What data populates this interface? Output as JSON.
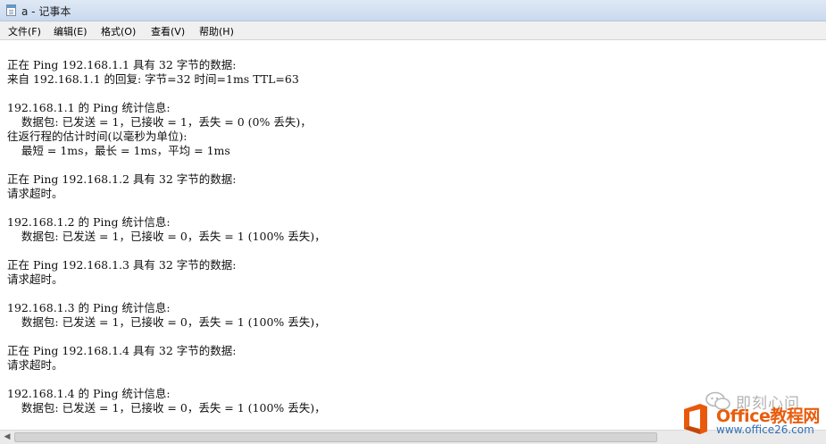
{
  "window": {
    "title": "a - 记事本"
  },
  "menu": [
    {
      "label": "文件(F)"
    },
    {
      "label": "编辑(E)"
    },
    {
      "label": "格式(O)"
    },
    {
      "label": "查看(V)"
    },
    {
      "label": "帮助(H)"
    }
  ],
  "document": {
    "lines": [
      "正在 Ping 192.168.1.1 具有 32 字节的数据:",
      "来自 192.168.1.1 的回复: 字节=32 时间=1ms TTL=63",
      "192.168.1.1 的 Ping 统计信息:",
      "    数据包: 已发送 = 1，已接收 = 1，丢失 = 0 (0% 丢失)，",
      "往返行程的估计时间(以毫秒为单位):",
      "    最短 = 1ms，最长 = 1ms，平均 = 1ms",
      "正在 Ping 192.168.1.2 具有 32 字节的数据:",
      "请求超时。",
      "192.168.1.2 的 Ping 统计信息:",
      "    数据包: 已发送 = 1，已接收 = 0，丢失 = 1 (100% 丢失)，",
      "正在 Ping 192.168.1.3 具有 32 字节的数据:",
      "请求超时。",
      "192.168.1.3 的 Ping 统计信息:",
      "    数据包: 已发送 = 1，已接收 = 0，丢失 = 1 (100% 丢失)，",
      "正在 Ping 192.168.1.4 具有 32 字节的数据:",
      "请求超时。",
      "192.168.1.4 的 Ping 统计信息:",
      "    数据包: 已发送 = 1，已接收 = 0，丢失 = 1 (100% 丢失)，"
    ]
  },
  "watermarks": {
    "wechat_text": "即刻心问",
    "brand": "Office教程网",
    "site": "www.office26.com"
  },
  "colors": {
    "brand_orange": "#e85d0d",
    "site_blue": "#2f6fb5"
  }
}
